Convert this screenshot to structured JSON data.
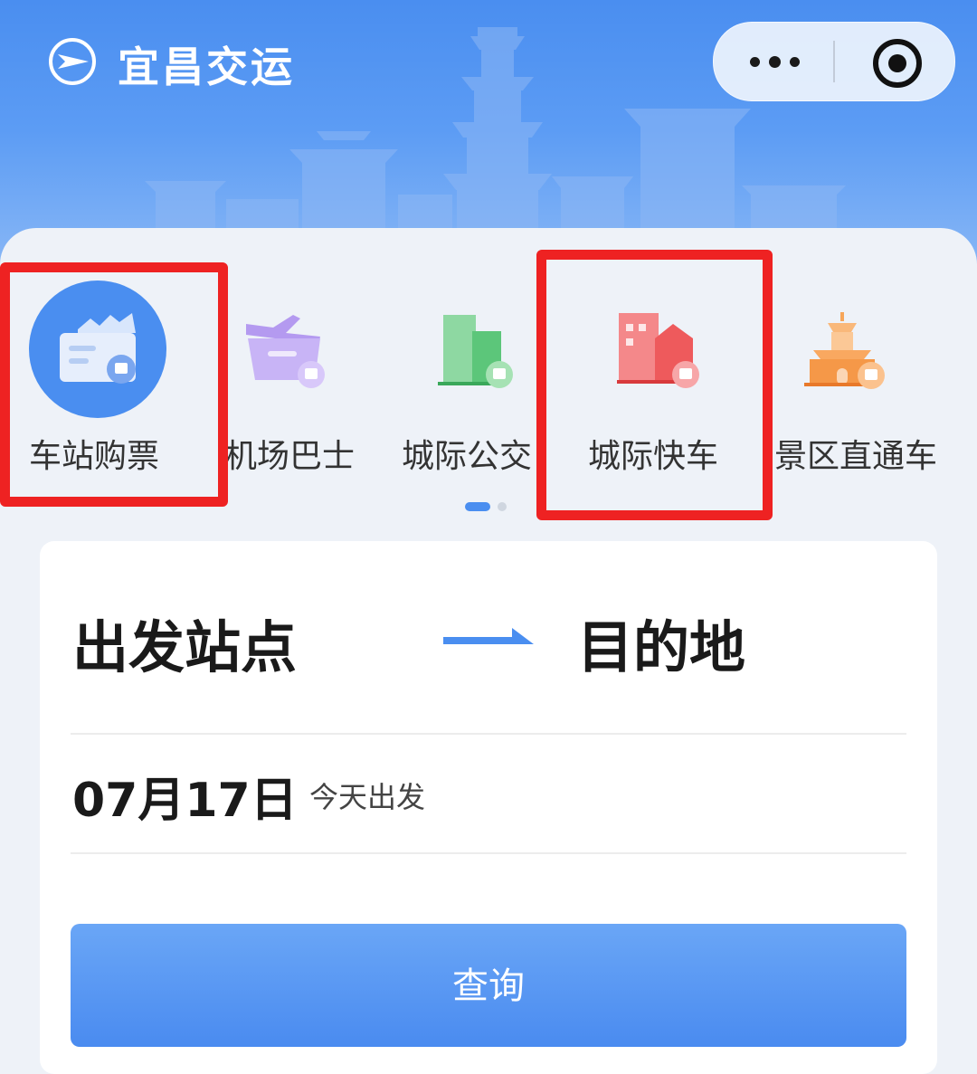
{
  "app": {
    "title": "宜昌交运"
  },
  "capsule": {
    "more_icon": "more-dots-icon",
    "close_icon": "target-close-icon"
  },
  "services": [
    {
      "label": "车站购票",
      "icon": "station-ticket-icon",
      "highlighted": true
    },
    {
      "label": "机场巴士",
      "icon": "airport-bus-icon",
      "highlighted": false
    },
    {
      "label": "城际公交",
      "icon": "intercity-bus-icon",
      "highlighted": false
    },
    {
      "label": "城际快车",
      "icon": "intercity-express-icon",
      "highlighted": true
    },
    {
      "label": "景区直通车",
      "icon": "scenic-shuttle-icon",
      "highlighted": false
    }
  ],
  "colors": {
    "accent": "#4a8ef0",
    "highlight": "#ee2222"
  },
  "pager": {
    "current": 1,
    "total": 2
  },
  "search": {
    "from": "出发站点",
    "to": "目的地",
    "date": "07月17日",
    "date_hint": "今天出发",
    "submit": "查询"
  }
}
